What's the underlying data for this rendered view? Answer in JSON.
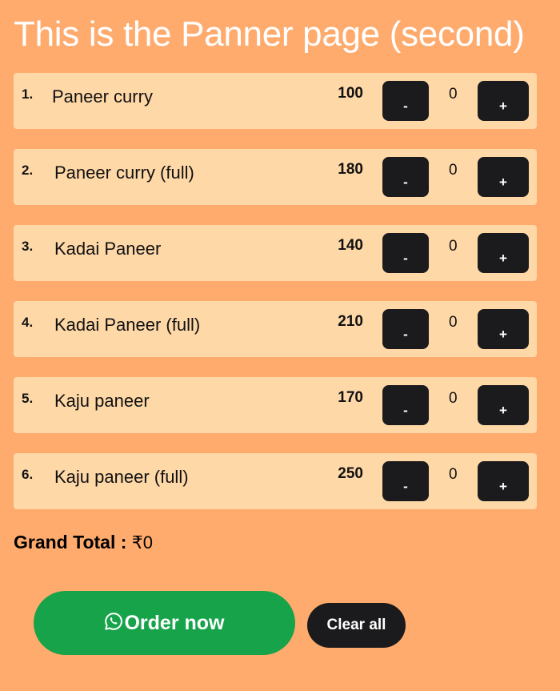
{
  "page_title": "This is the Panner page (second)",
  "colors": {
    "background": "#FFAB6E",
    "row_background": "#FFD8A8",
    "button_dark": "#1B1B1D",
    "order_green": "#17A34A"
  },
  "items": [
    {
      "number": "1.",
      "name": "Paneer curry",
      "price": "100",
      "quantity": "0",
      "minus_label": "-",
      "plus_label": "+"
    },
    {
      "number": "2.",
      "name": "Paneer curry (full)",
      "price": "180",
      "quantity": "0",
      "minus_label": "-",
      "plus_label": "+"
    },
    {
      "number": "3.",
      "name": "Kadai Paneer",
      "price": "140",
      "quantity": "0",
      "minus_label": "-",
      "plus_label": "+"
    },
    {
      "number": "4.",
      "name": "Kadai Paneer (full)",
      "price": "210",
      "quantity": "0",
      "minus_label": "-",
      "plus_label": "+"
    },
    {
      "number": "5.",
      "name": "Kaju paneer",
      "price": "170",
      "quantity": "0",
      "minus_label": "-",
      "plus_label": "+"
    },
    {
      "number": "6.",
      "name": "Kaju paneer (full)",
      "price": "250",
      "quantity": "0",
      "minus_label": "-",
      "plus_label": "+"
    }
  ],
  "grand_total": {
    "label": "Grand Total :",
    "value": "₹0"
  },
  "order_button": {
    "icon": "whatsapp-icon",
    "label": "Order now"
  },
  "clear_button": {
    "label": "Clear all"
  }
}
